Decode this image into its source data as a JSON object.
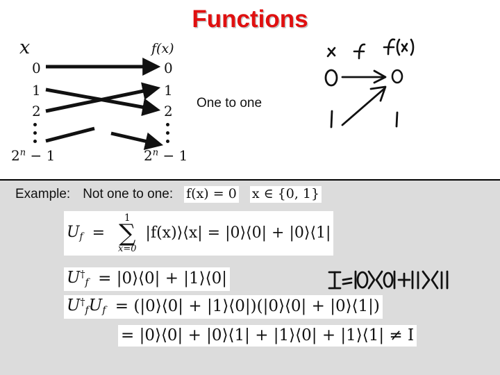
{
  "title": "Functions",
  "accent_color": "#e01010",
  "panel_color": "#dcdcdc",
  "mapping_diagram": {
    "domain_header": "x",
    "codomain_header": "f(x)",
    "domain_items": [
      "0",
      "1",
      "2"
    ],
    "codomain_items": [
      "0",
      "1",
      "2"
    ],
    "domain_last": "2n − 1",
    "codomain_last": "2n − 1",
    "domain_last_base": "2",
    "domain_last_exp": "n",
    "domain_last_tail": " − 1",
    "vertical_dots": "⋮"
  },
  "one_to_one_label": "One to one",
  "handwriting_top": {
    "header_x": "x",
    "header_f": "f",
    "header_fx": "f(x)",
    "domain_0": "0",
    "codomain_0": "0",
    "domain_1": "1",
    "codomain_1": "1"
  },
  "example": {
    "label": "Example:",
    "sublabel": "Not one to one:",
    "equation": "f(x) = 0",
    "domain_set": "x ∈ {0, 1}"
  },
  "formulas": {
    "line1_lhs": "U",
    "line1_lhs_sub": "f",
    "line1_eq": "=",
    "sum_upper": "1",
    "sum_symbol": "∑",
    "sum_lower": "x=0",
    "line1_body": "|f(x)⟩⟨x| = |0⟩⟨0| + |0⟩⟨1|",
    "line2": "U†f = |0⟩⟨0| + |1⟩⟨0|",
    "line2_body": "= |0⟩⟨0| + |1⟩⟨0|",
    "line3_body": "= (|0⟩⟨0| + |1⟩⟨0|)(|0⟩⟨0| + |0⟩⟨1|)",
    "line4_body": "= |0⟩⟨0| + |0⟩⟨1| + |1⟩⟨0| + |1⟩⟨1| ≠ I"
  },
  "handwriting_bottom": {
    "text": "I = |0⟩⟨0| + |1⟩⟨1|"
  }
}
